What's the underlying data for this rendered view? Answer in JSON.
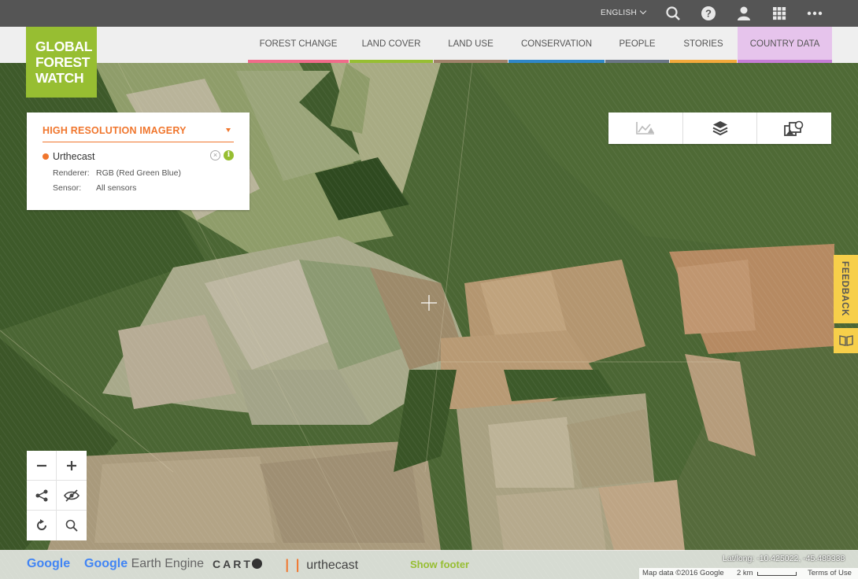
{
  "header": {
    "language": "ENGLISH",
    "icons": [
      "search-icon",
      "help-icon",
      "user-icon",
      "apps-grid-icon",
      "more-icon"
    ]
  },
  "logo": {
    "line1": "GLOBAL",
    "line2": "FOREST",
    "line3": "WATCH",
    "color": "#97be32"
  },
  "nav": {
    "items": [
      {
        "label": "FOREST CHANGE",
        "color": "#f06b8a"
      },
      {
        "label": "LAND COVER",
        "color": "#97be32"
      },
      {
        "label": "LAND USE",
        "color": "#a0826a"
      },
      {
        "label": "CONSERVATION",
        "color": "#2f87c8"
      },
      {
        "label": "PEOPLE",
        "color": "#6b7686"
      },
      {
        "label": "STORIES",
        "color": "#f3a93b"
      },
      {
        "label": "COUNTRY DATA",
        "color": "#c67dd6"
      }
    ]
  },
  "legend": {
    "title": "HIGH RESOLUTION IMAGERY",
    "layer": {
      "name": "Urthecast",
      "color": "#f0762d",
      "renderer_label": "Renderer:",
      "renderer_value": "RGB (Red Green Blue)",
      "sensor_label": "Sensor:",
      "sensor_value": "All sensors"
    }
  },
  "tools": [
    "analysis-icon",
    "layers-icon",
    "imagery-basemap-icon"
  ],
  "feedback": {
    "label": "FEEDBACK",
    "color": "#f7cf4a"
  },
  "controls": [
    "zoom-out-icon",
    "zoom-in-icon",
    "share-icon",
    "hide-icon",
    "refresh-icon",
    "search-icon"
  ],
  "footer": {
    "google": "Google",
    "earth_engine_google": "Google",
    "earth_engine": "Earth Engine",
    "carto": "CART",
    "urthecast": "urthecast",
    "show_footer": "Show footer",
    "latlong": "Lat/long: -10.425022, -45.489338",
    "map_data": "Map data ©2016 Google",
    "scale": "2 km",
    "terms": "Terms of Use"
  }
}
